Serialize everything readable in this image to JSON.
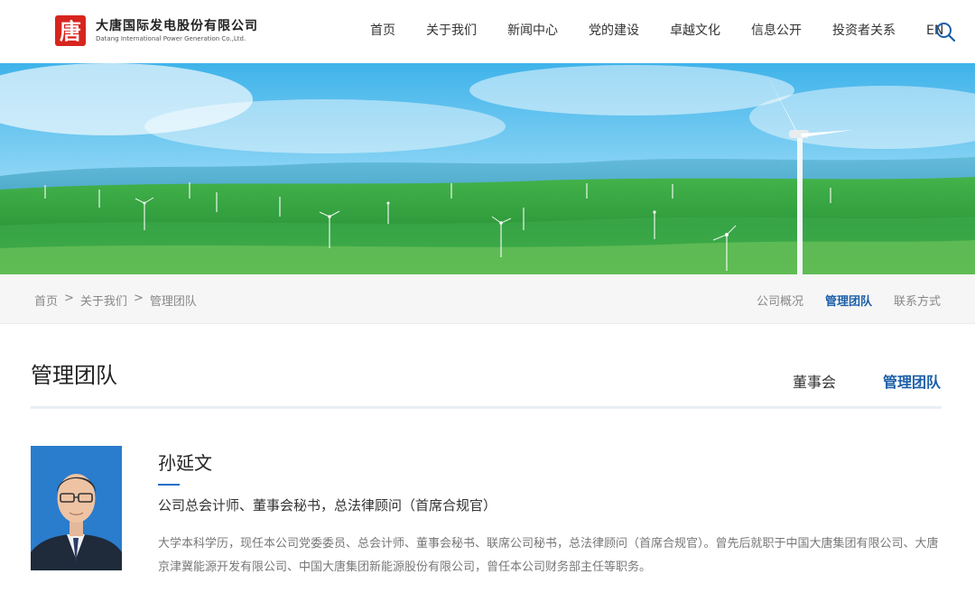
{
  "brand": {
    "name_cn": "大唐国际发电股份有限公司",
    "name_en": "Datang International Power Generation Co.,Ltd.",
    "logo_glyph": "唐",
    "logo_color": "#d7241e"
  },
  "nav": {
    "items": [
      "首页",
      "关于我们",
      "新闻中心",
      "党的建设",
      "卓越文化",
      "信息公开",
      "投资者关系",
      "EN"
    ],
    "search_icon": "search-icon"
  },
  "breadcrumb": {
    "items": [
      "首页",
      "关于我们",
      "管理团队"
    ],
    "separator": ">"
  },
  "subnav": {
    "items": [
      "公司概况",
      "管理团队",
      "联系方式"
    ],
    "active": "管理团队"
  },
  "section": {
    "title": "管理团队",
    "tabs": [
      "董事会",
      "管理团队"
    ],
    "active_tab": "管理团队"
  },
  "person": {
    "name": "孙延文",
    "title": "公司总会计师、董事会秘书，总法律顾问（首席合规官）",
    "description": "大学本科学历，现任本公司党委委员、总会计师、董事会秘书、联席公司秘书，总法律顾问（首席合规官）。曾先后就职于中国大唐集团有限公司、大唐京津冀能源开发有限公司、中国大唐集团新能源股份有限公司，曾任本公司财务部主任等职务。"
  },
  "colors": {
    "accent": "#1b5fa8",
    "logo_red": "#d7241e"
  }
}
